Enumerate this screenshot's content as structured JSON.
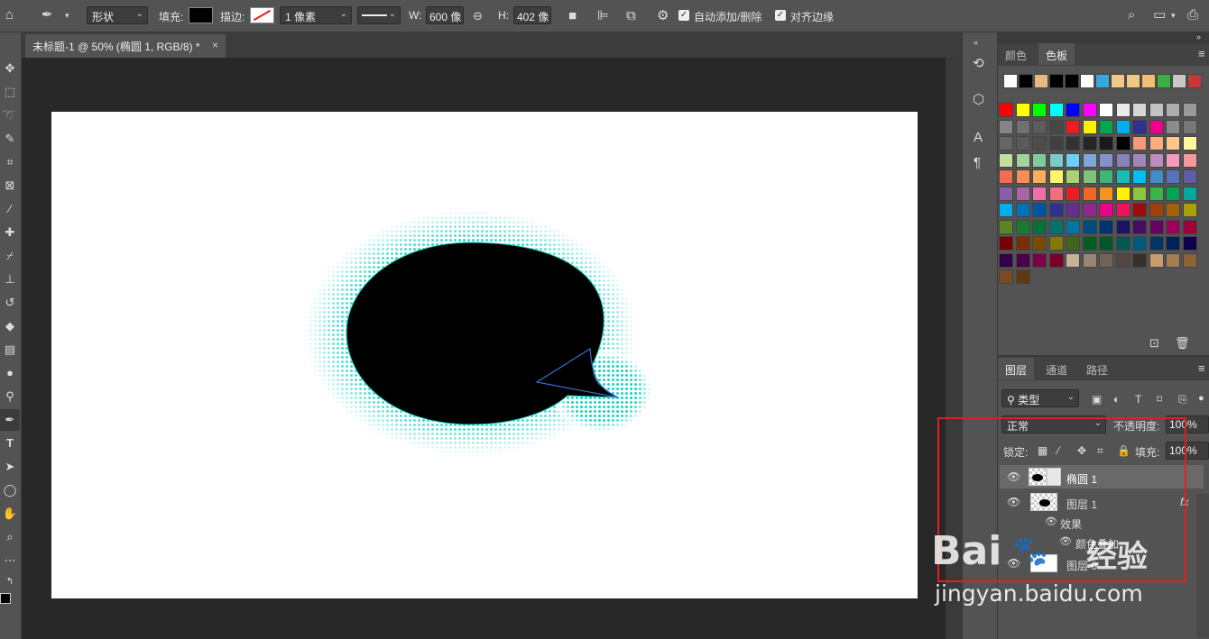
{
  "options_bar": {
    "tool_mode": "形状",
    "fill_label": "填充:",
    "stroke_label": "描边:",
    "stroke_width": "1 像素",
    "w_label": "W:",
    "w_value": "600 像",
    "h_label": "H:",
    "h_value": "402 像",
    "auto_add_delete": "自动添加/删除",
    "align_edges": "对齐边缘"
  },
  "document_tab": {
    "title": "未标题-1 @ 50% (椭圆 1, RGB/8) *",
    "close": "×"
  },
  "color_panel": {
    "tabs": [
      "颜色",
      "色板"
    ],
    "recent_swatches": [
      "#ffffff",
      "#000000",
      "#e8b882",
      "#000000",
      "#000000",
      "#ffffff",
      "#3aa8e0",
      "#f0c888",
      "#f0c880",
      "#f0c070",
      "#3ab040",
      "#c8c8c8",
      "#c83838"
    ],
    "swatch_rows": [
      [
        "#ff0000",
        "#ffff00",
        "#00ff00",
        "#00ffff",
        "#0000ff",
        "#ff00ff",
        "#ffffff",
        "#ebebeb",
        "#d6d6d6",
        "#c2c2c2",
        "#adadad",
        "#999999"
      ],
      [
        "#858585",
        "#707070",
        "#5c5c5c",
        "#474747",
        "#ed1c24",
        "#fff200",
        "#00a651",
        "#00aeef",
        "#2e3192",
        "#ec008c",
        "#8c8c8c",
        "#787878"
      ],
      [
        "#666666",
        "#5a5a5a",
        "#4d4d4d",
        "#404040",
        "#333333",
        "#262626",
        "#1a1a1a",
        "#000000",
        "#f7977a",
        "#fbad82",
        "#fdc68c",
        "#fff799"
      ],
      [
        "#c4df9b",
        "#a3d39c",
        "#82ca9c",
        "#7accc8",
        "#6dcff6",
        "#7da7d9",
        "#8393ca",
        "#8781bd",
        "#a186be",
        "#bd8cbf",
        "#f49ac1",
        "#f6989d"
      ],
      [
        "#f26c4f",
        "#f68e56",
        "#fbaf5d",
        "#fff568",
        "#acd373",
        "#7cc576",
        "#3bb878",
        "#1abbb4",
        "#00bff3",
        "#438ccb",
        "#5574b9",
        "#605ca8"
      ],
      [
        "#8560a8",
        "#a864a8",
        "#f06eaa",
        "#f26d7d",
        "#ed1c24",
        "#f26522",
        "#f7941d",
        "#fff200",
        "#8dc63f",
        "#39b54a",
        "#00a651",
        "#00a99d"
      ],
      [
        "#00aeef",
        "#0072bc",
        "#0054a6",
        "#2e3192",
        "#662d91",
        "#92278f",
        "#ec008c",
        "#ed145b",
        "#9e0b0f",
        "#a0410d",
        "#a3620a",
        "#aba000"
      ],
      [
        "#598527",
        "#197b30",
        "#007236",
        "#00746b",
        "#0076a3",
        "#004b80",
        "#003471",
        "#1b1464",
        "#440e62",
        "#630460",
        "#9e005d",
        "#9e0039"
      ],
      [
        "#790000",
        "#7b2e00",
        "#7d4900",
        "#827b00",
        "#406618",
        "#005e20",
        "#005826",
        "#005952",
        "#005b7f",
        "#003663",
        "#002157",
        "#0d004c"
      ],
      [
        "#32004b",
        "#4b0049",
        "#7b0046",
        "#7a0026",
        "#c7b299",
        "#998675",
        "#736357",
        "#534741",
        "#37302d",
        "#c69c6d",
        "#a67c52",
        "#8c6239"
      ],
      [
        "#754c24",
        "#603913"
      ]
    ]
  },
  "layers_panel": {
    "tabs": [
      "图层",
      "通道",
      "路径"
    ],
    "filter_label": "类型",
    "blend_mode": "正常",
    "opacity_label": "不透明度:",
    "opacity_value": "100%",
    "lock_label": "锁定:",
    "fill_label": "填充:",
    "fill_value": "100%",
    "layers": [
      {
        "name": "椭圆 1",
        "selected": true
      },
      {
        "name": "图层 1",
        "fx": "fx"
      },
      {
        "name": "效果",
        "sub": 1
      },
      {
        "name": "颜色叠加",
        "sub": 2
      },
      {
        "name": "图层 0"
      }
    ]
  },
  "watermark": {
    "brand": "Bai",
    "brand_cn": "经验",
    "url": "jingyan.baidu.com"
  },
  "colors": {
    "highlight_box": "#e02020",
    "halftone": "#19d3c5",
    "path_stroke": "#3a6fd0"
  }
}
